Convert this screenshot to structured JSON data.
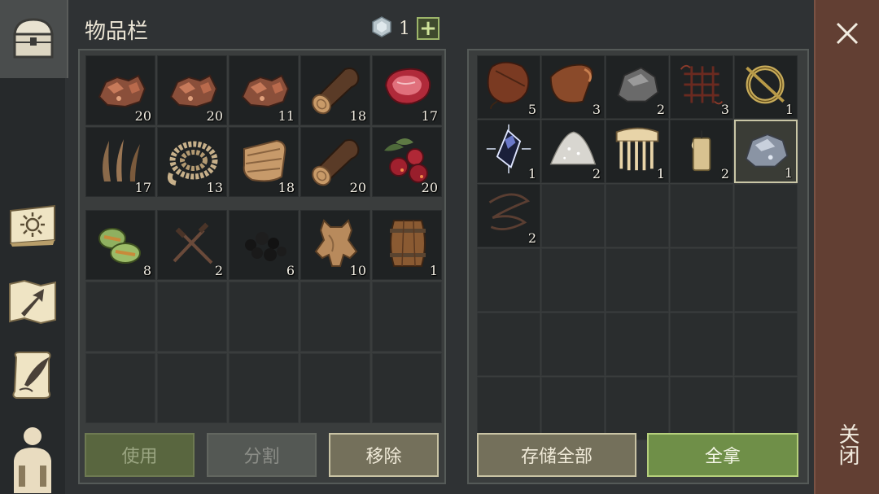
{
  "header": {
    "title": "物品栏",
    "gem_count": "1",
    "plus_label": "+"
  },
  "inventory": {
    "items": [
      {
        "icon": "copper-ore-icon",
        "qty": "20"
      },
      {
        "icon": "copper-ore-icon",
        "qty": "20"
      },
      {
        "icon": "copper-ore-icon",
        "qty": "11"
      },
      {
        "icon": "log-icon",
        "qty": "18"
      },
      {
        "icon": "raw-meat-icon",
        "qty": "17"
      },
      {
        "icon": "plant-fiber-icon",
        "qty": "17"
      },
      {
        "icon": "rope-icon",
        "qty": "13"
      },
      {
        "icon": "cloth-icon",
        "qty": "18"
      },
      {
        "icon": "log-icon",
        "qty": "20"
      },
      {
        "icon": "berries-icon",
        "qty": "20"
      },
      {
        "icon": "cooked-food-icon",
        "qty": "8"
      },
      {
        "icon": "nails-icon",
        "qty": "2"
      },
      {
        "icon": "coal-icon",
        "qty": "6"
      },
      {
        "icon": "hide-icon",
        "qty": "10"
      },
      {
        "icon": "barrel-icon",
        "qty": "1"
      }
    ]
  },
  "storage": {
    "items": [
      {
        "icon": "waterskin-icon",
        "qty": "5"
      },
      {
        "icon": "leather-icon",
        "qty": "3"
      },
      {
        "icon": "stone-icon",
        "qty": "2"
      },
      {
        "icon": "sinew-icon",
        "qty": "3"
      },
      {
        "icon": "brooch-icon",
        "qty": "1"
      },
      {
        "icon": "crystal-icon",
        "qty": "1"
      },
      {
        "icon": "salt-pile-icon",
        "qty": "2"
      },
      {
        "icon": "comb-icon",
        "qty": "1"
      },
      {
        "icon": "candle-icon",
        "qty": "2"
      },
      {
        "icon": "iron-ore-icon",
        "qty": "1"
      },
      {
        "icon": "wire-icon",
        "qty": "2"
      }
    ]
  },
  "buttons": {
    "use": "使用",
    "split": "分割",
    "remove": "移除",
    "store_all": "存储全部",
    "take_all": "全拿"
  },
  "close": {
    "label": "关闭"
  }
}
